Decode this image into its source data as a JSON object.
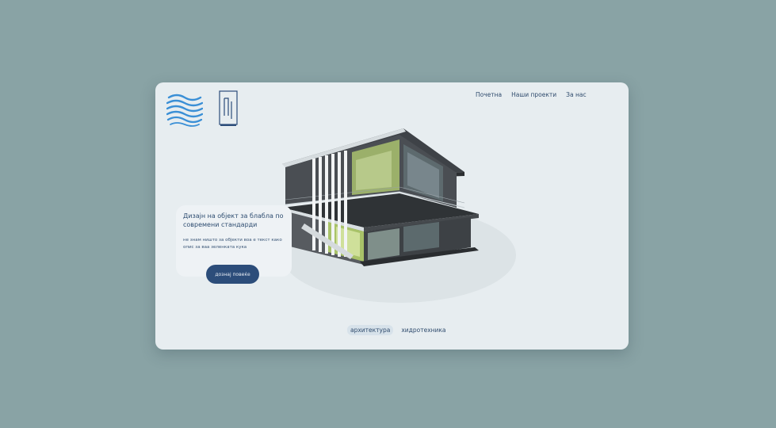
{
  "header": {
    "logo_wave": "wave-logo-icon",
    "logo_mono": "monogram-logo-icon"
  },
  "nav": {
    "items": [
      "Почетна",
      "Наши проекти",
      "За нас"
    ]
  },
  "hero": {
    "title": "Дизајн на објект за блабла по современи стандарди",
    "description": "не знам ништо за објекти воа е текст како опис за ваа зеленката кука",
    "cta_label": "дознај повеќе"
  },
  "tabs": {
    "items": [
      "архитектура",
      "хидротехника"
    ],
    "active_index": 0
  },
  "colors": {
    "page_background": "#89a3a5",
    "card_background": "#e7edf0",
    "accent": "#2c4d7a",
    "text": "#2f4b6d",
    "wave_blue": "#3a8fd6"
  }
}
